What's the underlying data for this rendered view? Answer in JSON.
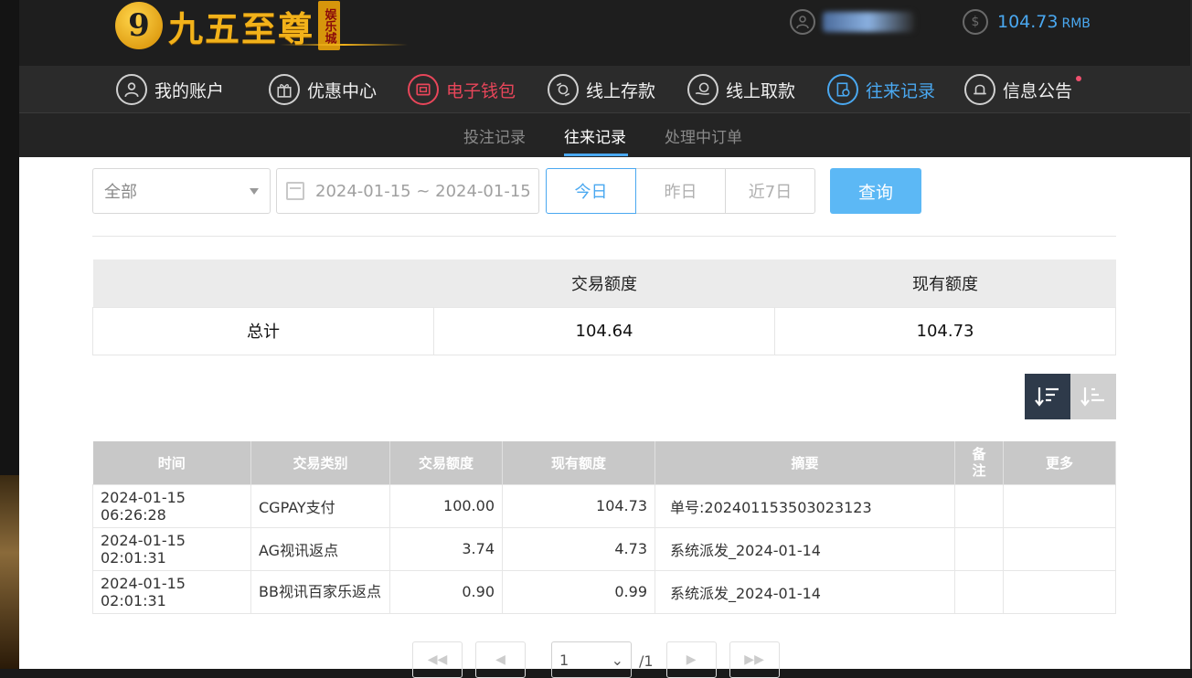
{
  "brand": {
    "logo_mark": "9",
    "name": "九五至尊",
    "tag": "娱乐城"
  },
  "account": {
    "balance": "104.73",
    "currency": "RMB"
  },
  "nav": [
    {
      "label": "我的账户",
      "icon": "user-icon"
    },
    {
      "label": "优惠中心",
      "icon": "gift-icon"
    },
    {
      "label": "电子钱包",
      "icon": "wallet-icon"
    },
    {
      "label": "线上存款",
      "icon": "deposit-icon"
    },
    {
      "label": "线上取款",
      "icon": "withdraw-icon"
    },
    {
      "label": "往来记录",
      "icon": "records-icon"
    },
    {
      "label": "信息公告",
      "icon": "bell-icon"
    }
  ],
  "subnav": {
    "bets": "投注记录",
    "transactions": "往来记录",
    "pending": "处理中订单"
  },
  "filters": {
    "type_value": "全部",
    "date_range": "2024-01-15 ~ 2024-01-15",
    "today": "今日",
    "yesterday": "昨日",
    "last7": "近7日",
    "query": "查询"
  },
  "summary": {
    "headers": [
      "",
      "交易额度",
      "现有额度"
    ],
    "row_label": "总计",
    "amount": "104.64",
    "balance": "104.73"
  },
  "table": {
    "headers": [
      "时间",
      "交易类别",
      "交易额度",
      "现有额度",
      "摘要",
      "备注",
      "更多"
    ],
    "rows": [
      [
        "2024-01-15 06:26:28",
        "CGPAY支付",
        "100.00",
        "104.73",
        "单号:202401153503023123",
        "",
        ""
      ],
      [
        "2024-01-15 02:01:31",
        "AG视讯返点",
        "3.74",
        "4.73",
        "系统派发_2024-01-14",
        "",
        ""
      ],
      [
        "2024-01-15 02:01:31",
        "BB视讯百家乐返点",
        "0.90",
        "0.99",
        "系统派发_2024-01-14",
        "",
        ""
      ]
    ]
  },
  "pager": {
    "page": "1",
    "total": "/1"
  },
  "colors": {
    "accent": "#4aa8f0",
    "danger": "#e8465a",
    "gold": "#f2b21a"
  }
}
